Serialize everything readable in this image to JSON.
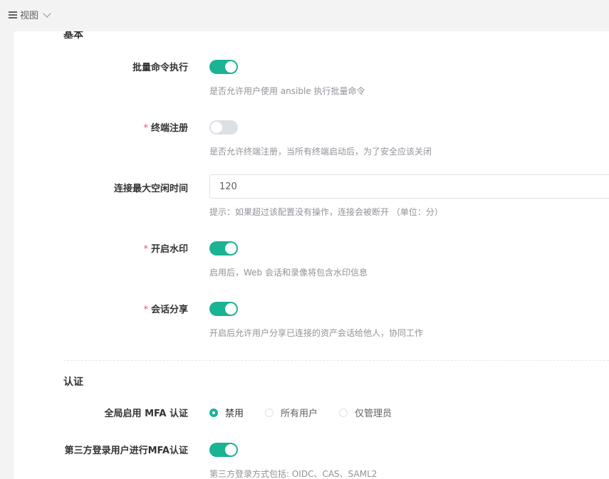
{
  "topbar": {
    "view_label": "视图"
  },
  "basic": {
    "title": "基本",
    "batch_cmd": {
      "label": "批量命令执行",
      "enabled": true,
      "help": "是否允许用户使用 ansible 执行批量命令"
    },
    "terminal_register": {
      "label": "终端注册",
      "required_mark": "*",
      "enabled": false,
      "help": "是否允许终端注册，当所有终端启动后，为了安全应该关闭"
    },
    "idle_timeout": {
      "label": "连接最大空闲时间",
      "value": "120",
      "help": "提示：如果超过该配置没有操作，连接会被断开 （单位：分）"
    },
    "watermark": {
      "label": "开启水印",
      "required_mark": "*",
      "enabled": true,
      "help": "启用后，Web 会话和录像将包含水印信息"
    },
    "session_share": {
      "label": "会话分享",
      "required_mark": "*",
      "enabled": true,
      "help": "开启后允许用户分享已连接的资产会话给他人，协同工作"
    }
  },
  "auth": {
    "title": "认证",
    "global_mfa": {
      "label": "全局启用 MFA 认证",
      "options": [
        "禁用",
        "所有用户",
        "仅管理员"
      ],
      "selected": "禁用"
    },
    "third_party_mfa": {
      "label": "第三方登录用户进行MFA认证",
      "enabled": true,
      "help": "第三方登录方式包括: OIDC、CAS、SAML2"
    }
  },
  "colors": {
    "accent": "#1ab394",
    "required": "#ed5565",
    "switch_off": "#dcdfe6",
    "help_text": "#909399"
  }
}
